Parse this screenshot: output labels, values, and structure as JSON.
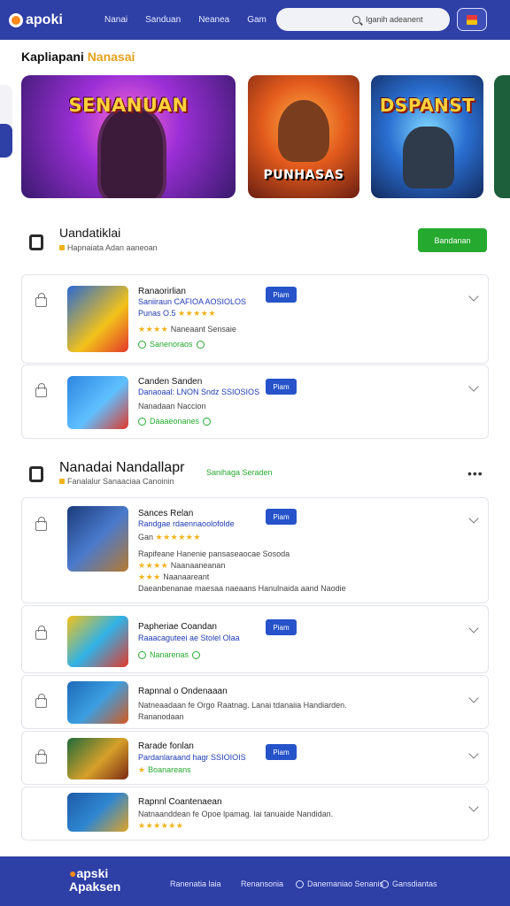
{
  "header": {
    "logo_text": "apoki",
    "nav": [
      "Nanai",
      "Sanduan",
      "Neanea",
      "Gam"
    ],
    "search_placeholder": "Iganih adeanent"
  },
  "featured": {
    "title_main": "Kapliapani",
    "title_accent": "Nanasai",
    "banners": [
      {
        "title": "SENANUAN"
      },
      {
        "title": "PUNHASAS"
      },
      {
        "title": "DSPANST"
      }
    ]
  },
  "section1": {
    "title": "Uandatiklai",
    "subtitle": "Hapnaiata Adan aaneoan",
    "button": "Bandanan",
    "cards": [
      {
        "title": "Ranaorirlian",
        "line1": "Saniiraun CAFIOA AOSIOLOS",
        "line2": "Punas O.5",
        "rating_line": "Naneaant Sensaie",
        "status": "Sanenoraos"
      },
      {
        "title": "Canden Sanden",
        "line1": "Danaoaal: LNON Sndz SSIOSIOS",
        "line2": "Nanadaan Naccion",
        "status": "Daaaeonanes"
      }
    ]
  },
  "section2": {
    "title": "Nanadai Nandallapr",
    "subtitle": "Fanalalur Sanaaciaa Canoinin",
    "link": "Sanihaga Seraden",
    "cards": [
      {
        "title": "Sances Relan",
        "line1": "Randgae rdaennaoolofolde",
        "line2": "Gan",
        "line3": "Rapifeane Hanenie pansaseaocae Sosoda",
        "line4": "Naanaaneanan",
        "line5": "Naanaareant",
        "line6": "Daeanbenanae maesaa naeaans Hanulnaida aand Naodie"
      },
      {
        "title": "Papheriae Coandan",
        "line1": "Raaacaguteei ae Stolel Olaa",
        "status": "Nanarenas"
      },
      {
        "title": "Rapnnal o Ondenaaan",
        "line1": "Natneaadaan fe Orgo Raatnag. Lanai tdanaiia Handiarden.",
        "line2": "Rananodaan"
      },
      {
        "title": "Rarade fonlan",
        "line1": "Pardanlaraand hagr SSIOIOIS",
        "line2": "Boanareans"
      },
      {
        "title": "Rapnnl Coantenaean",
        "line1": "Natnaanddean fe Opoe lpamag. lai tanuaide Nandidan.",
        "line2": ""
      }
    ],
    "pill_label": "Piam"
  },
  "footer": {
    "logo_top": "apski",
    "logo_bottom": "Apaksen",
    "links": [
      "Ranenatia laia",
      "Renansonia",
      "Danemaniao Senanis",
      "Gansdiantas"
    ]
  },
  "colors": {
    "primary": "#2e3fa6",
    "accent_green": "#25a92e",
    "pill_blue": "#2653c9",
    "star": "#f2b21a"
  }
}
